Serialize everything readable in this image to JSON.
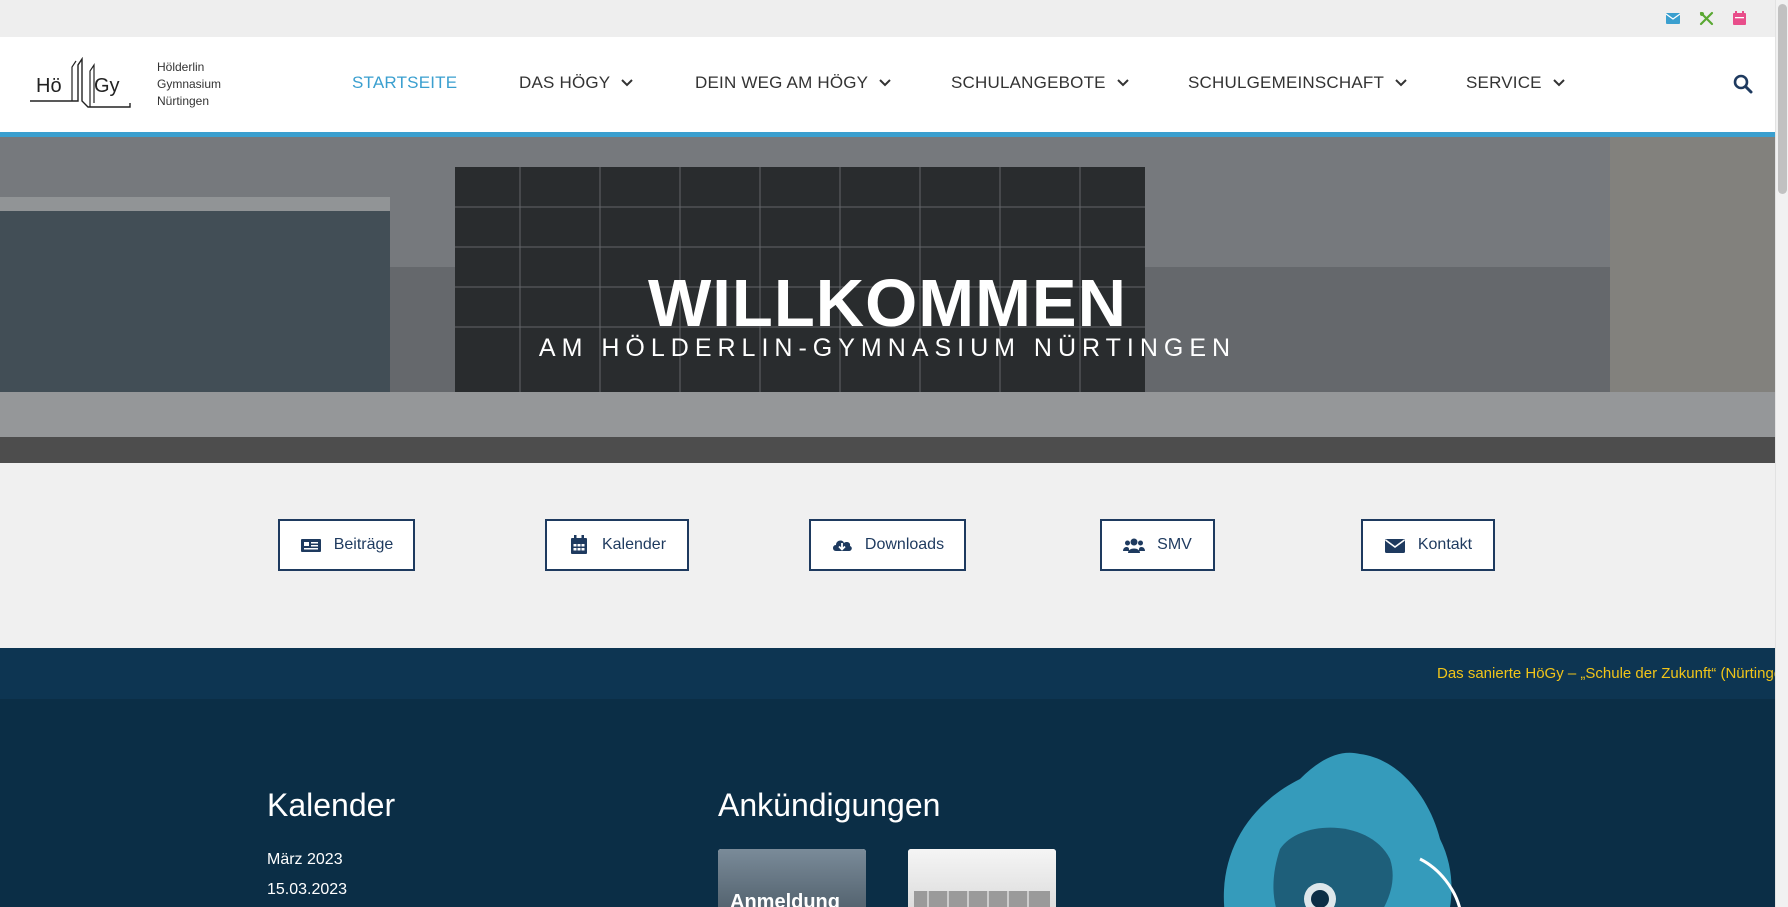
{
  "topbar": {
    "icons": [
      "envelope-icon",
      "utensils-icon",
      "calendar-icon"
    ]
  },
  "logo": {
    "line1": "Hölderlin",
    "line2": "Gymnasium",
    "line3": "Nürtingen",
    "mark_left": "Hö",
    "mark_right": "Gy"
  },
  "nav": {
    "items": [
      {
        "label": "STARTSEITE"
      },
      {
        "label": "DAS HÖGY"
      },
      {
        "label": "DEIN WEG AM HÖGY"
      },
      {
        "label": "SCHULANGEBOTE"
      },
      {
        "label": "SCHULGEMEINSCHAFT"
      },
      {
        "label": "SERVICE"
      }
    ],
    "active_color": "#3a9fcf"
  },
  "hero": {
    "title": "WILLKOMMEN",
    "subtitle": "AM HÖLDERLIN-GYMNASIUM NÜRTINGEN"
  },
  "quicklinks": [
    {
      "label": "Beiträge",
      "icon": "newspaper-icon"
    },
    {
      "label": "Kalender",
      "icon": "calendar-icon"
    },
    {
      "label": "Downloads",
      "icon": "cloud-download-icon"
    },
    {
      "label": "SMV",
      "icon": "users-icon"
    },
    {
      "label": "Kontakt",
      "icon": "envelope-icon"
    }
  ],
  "ticker": {
    "text": "Das sanierte HöGy – „Schule der Zukunft“ (Nürtinger Z"
  },
  "calendar": {
    "title": "Kalender",
    "month": "März 2023",
    "date": "15.03.2023"
  },
  "announcements": {
    "title": "Ankündigungen",
    "card1_text": "Anmeldung"
  },
  "colors": {
    "accent": "#3a9fcf",
    "dark_navy": "#0b2e46",
    "ticker_bg": "#0d3552",
    "ticker_text": "#f0c419",
    "button_border": "#1e3a5f"
  }
}
